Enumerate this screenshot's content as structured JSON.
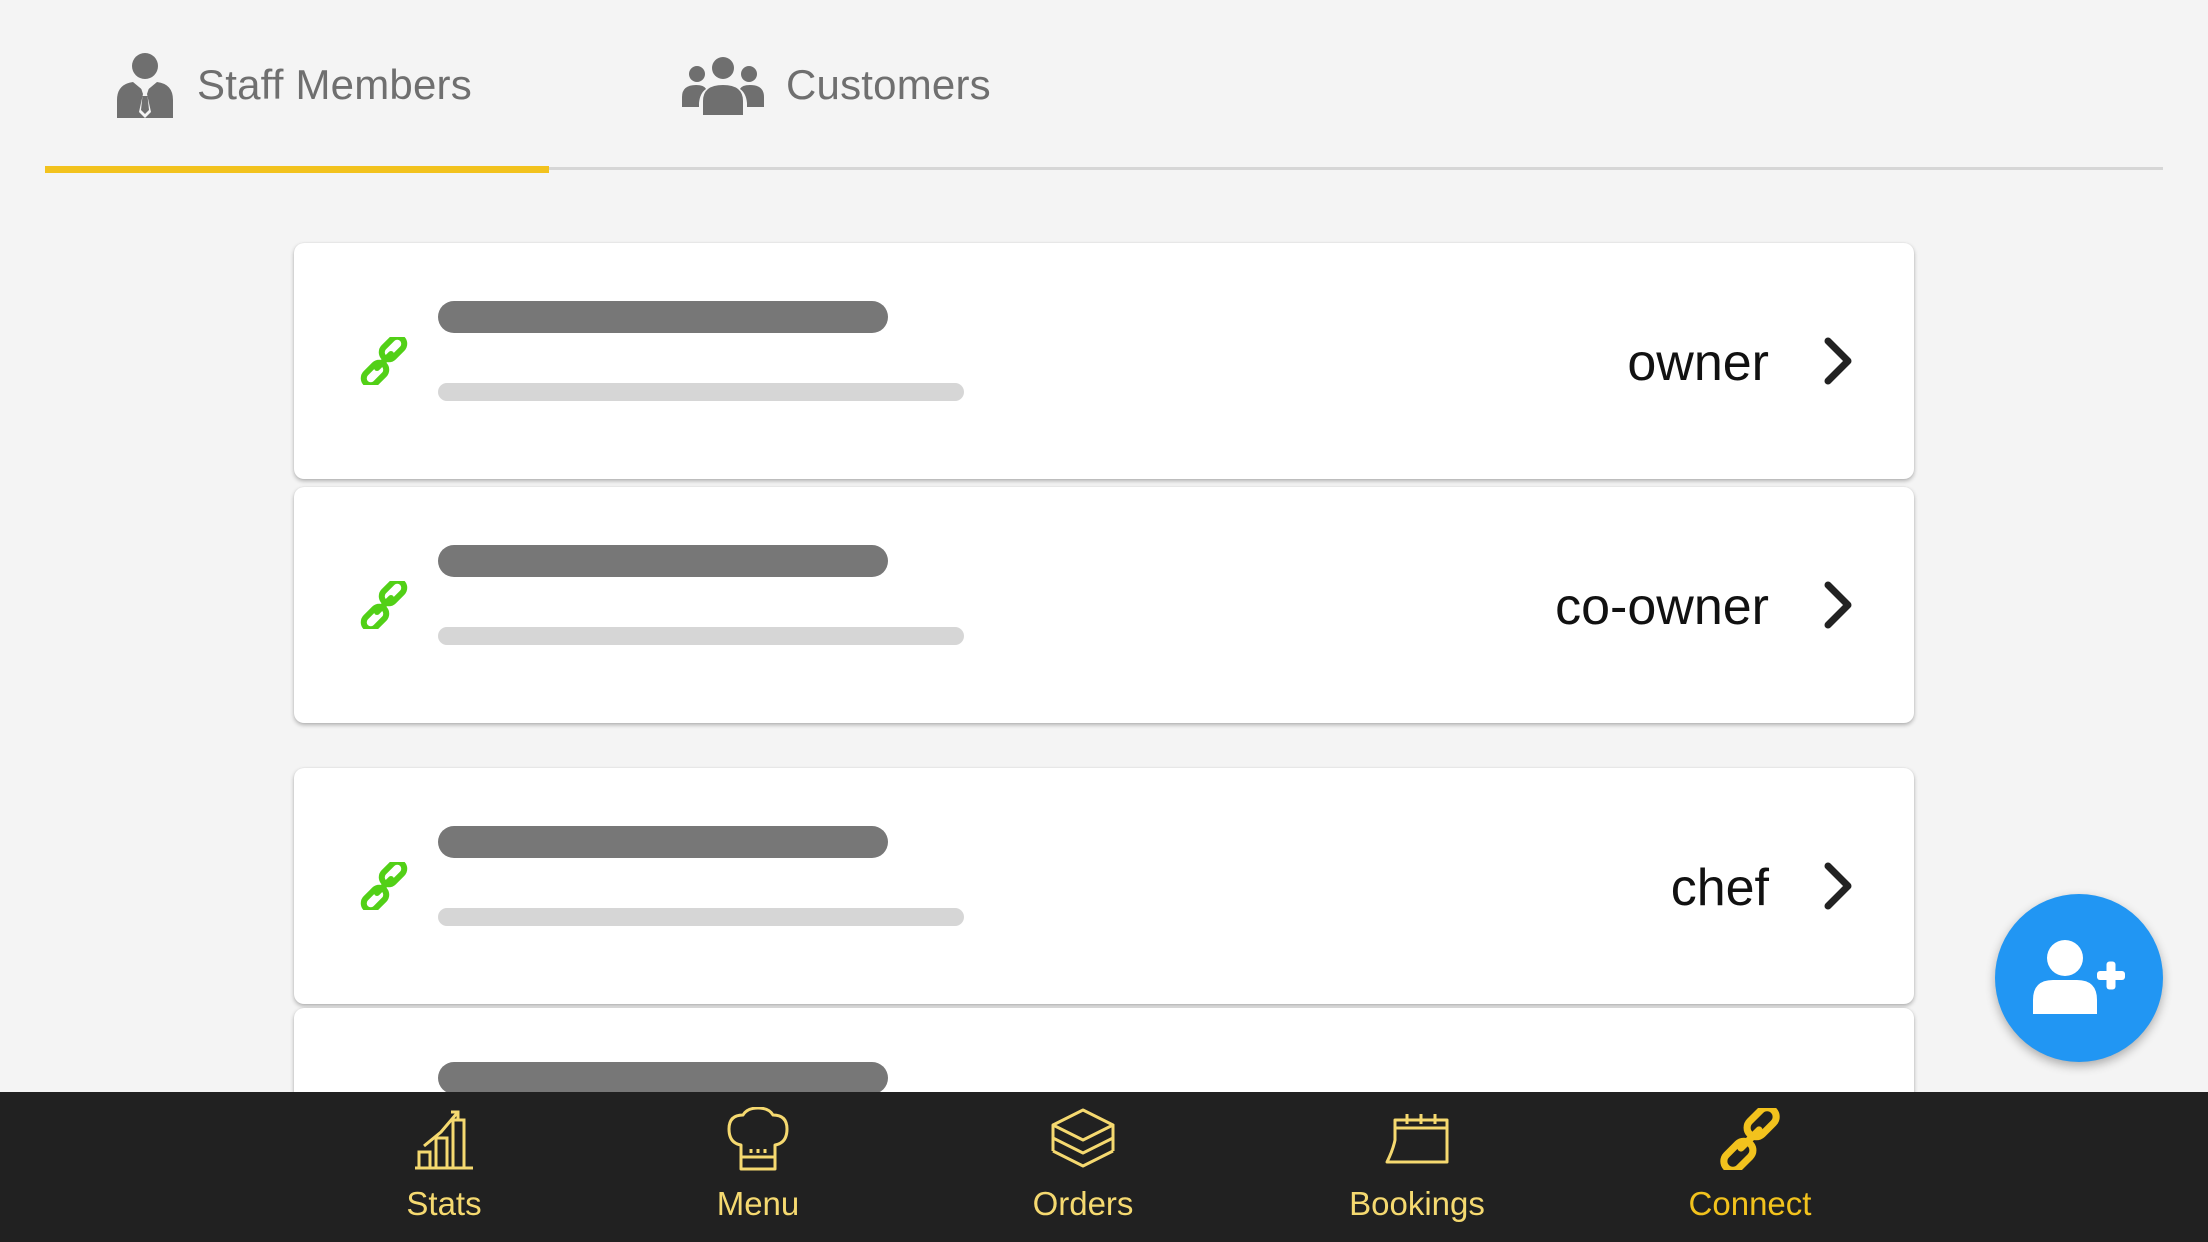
{
  "tabs": {
    "staff": {
      "label": "Staff Members",
      "icon": "staff-person-icon",
      "active": true
    },
    "customers": {
      "label": "Customers",
      "icon": "customers-group-icon",
      "active": false
    }
  },
  "staff_list": {
    "items": [
      {
        "role": "owner",
        "icon": "link-icon"
      },
      {
        "role": "co-owner",
        "icon": "link-icon"
      },
      {
        "role": "chef",
        "icon": "link-icon"
      },
      {
        "role": "",
        "icon": ""
      }
    ]
  },
  "fab": {
    "icon": "add-user-icon",
    "color": "#2196f3"
  },
  "bottom_nav": {
    "items": [
      {
        "label": "Stats",
        "icon": "stats-icon",
        "active": false
      },
      {
        "label": "Menu",
        "icon": "chef-hat-icon",
        "active": false
      },
      {
        "label": "Orders",
        "icon": "layers-icon",
        "active": false
      },
      {
        "label": "Bookings",
        "icon": "calendar-icon",
        "active": false
      },
      {
        "label": "Connect",
        "icon": "link-icon",
        "active": true
      }
    ]
  },
  "colors": {
    "accent": "#f2c21d",
    "nav_background": "#212121",
    "link_icon": "#52d017",
    "fab": "#2196f3"
  }
}
